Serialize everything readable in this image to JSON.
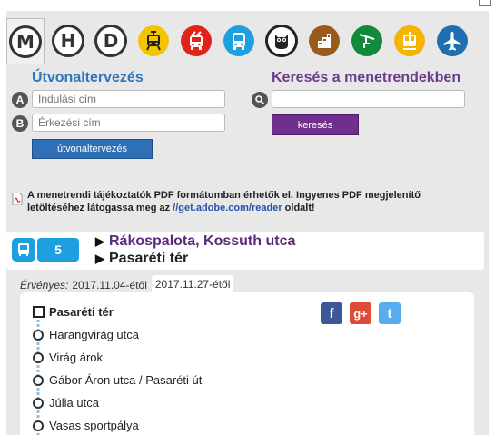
{
  "modes": [
    {
      "name": "metro",
      "glyph": "M",
      "color": "#333333",
      "selected": true
    },
    {
      "name": "hev",
      "glyph": "H",
      "color": "#333333",
      "selected": false
    },
    {
      "name": "ferry",
      "glyph": "D",
      "color": "#333333",
      "selected": false
    },
    {
      "name": "tram",
      "color": "#f5c400",
      "selected": false
    },
    {
      "name": "trolleybus",
      "color": "#e2231a",
      "selected": false
    },
    {
      "name": "bus",
      "color": "#1ea0e0",
      "selected": false
    },
    {
      "name": "night-bus",
      "color": "#222222",
      "selected": false
    },
    {
      "name": "cogwheel",
      "color": "#9a5a1c",
      "selected": false
    },
    {
      "name": "chairlift",
      "color": "#128a3c",
      "selected": false
    },
    {
      "name": "funicular",
      "color": "#f5b400",
      "selected": false
    },
    {
      "name": "airport",
      "color": "#1f6fb0",
      "selected": false
    }
  ],
  "planner": {
    "title": "Útvonaltervezés",
    "from_badge": "A",
    "to_badge": "B",
    "from_placeholder": "Indulási cím",
    "to_placeholder": "Érkezési cím",
    "button": "útvonaltervezés"
  },
  "search": {
    "title": "Keresés a menetrendekben",
    "placeholder": "",
    "button": "keresés"
  },
  "pdf_note": {
    "text": "A menetrendi tájékoztatók PDF formátumban érhetők el. Ingyenes PDF megjelenítő letöltéséhez látogassa meg az ",
    "link": "//get.adobe.com/reader",
    "suffix": " oldalt!"
  },
  "route": {
    "line": "5",
    "from": "Rákospalota, Kossuth utca",
    "to": "Pasaréti tér"
  },
  "validity": {
    "label": "Érvényes:",
    "date1": "2017.11.04-étől",
    "date2": "2017.11.27-étől"
  },
  "stops": [
    "Pasaréti tér",
    "Harangvirág utca",
    "Virág árok",
    "Gábor Áron utca / Pasaréti út",
    "Júlia utca",
    "Vasas sportpálya"
  ],
  "colors": {
    "plan_blue": "#2d77bb",
    "search_purple": "#6b3b8e",
    "route_blue": "#1ea0e0",
    "facebook": "#3b5998",
    "googleplus": "#dd4b39",
    "twitter": "#55acee"
  },
  "social": {
    "facebook_glyph": "f",
    "googleplus_glyph": "g+",
    "twitter_glyph": "t"
  }
}
